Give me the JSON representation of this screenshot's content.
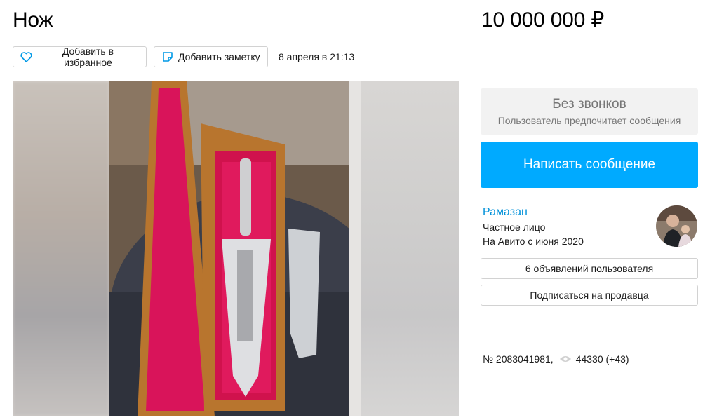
{
  "listing": {
    "title": "Нож",
    "price": "10 000 000 ₽",
    "date": "8 апреля в 21:13",
    "number": "№ 2083041981,",
    "views": "44330 (+43)"
  },
  "actions": {
    "favorite_label": "Добавить в избранное",
    "note_label": "Добавить заметку"
  },
  "contact": {
    "no_calls_title": "Без звонков",
    "no_calls_subtitle": "Пользователь предпочитает сообщения",
    "write_label": "Написать сообщение"
  },
  "seller": {
    "name": "Рамазан",
    "type": "Частное лицо",
    "since": "На Авито с июня 2020",
    "ads_label": "6 объявлений пользователя",
    "subscribe_label": "Подписаться на продавца"
  },
  "icons": {
    "favorite": "heart-icon",
    "note": "note-icon",
    "views": "eye-icon"
  },
  "colors": {
    "accent": "#00aaff",
    "link": "#0091d9",
    "muted_bg": "#f2f2f2"
  }
}
